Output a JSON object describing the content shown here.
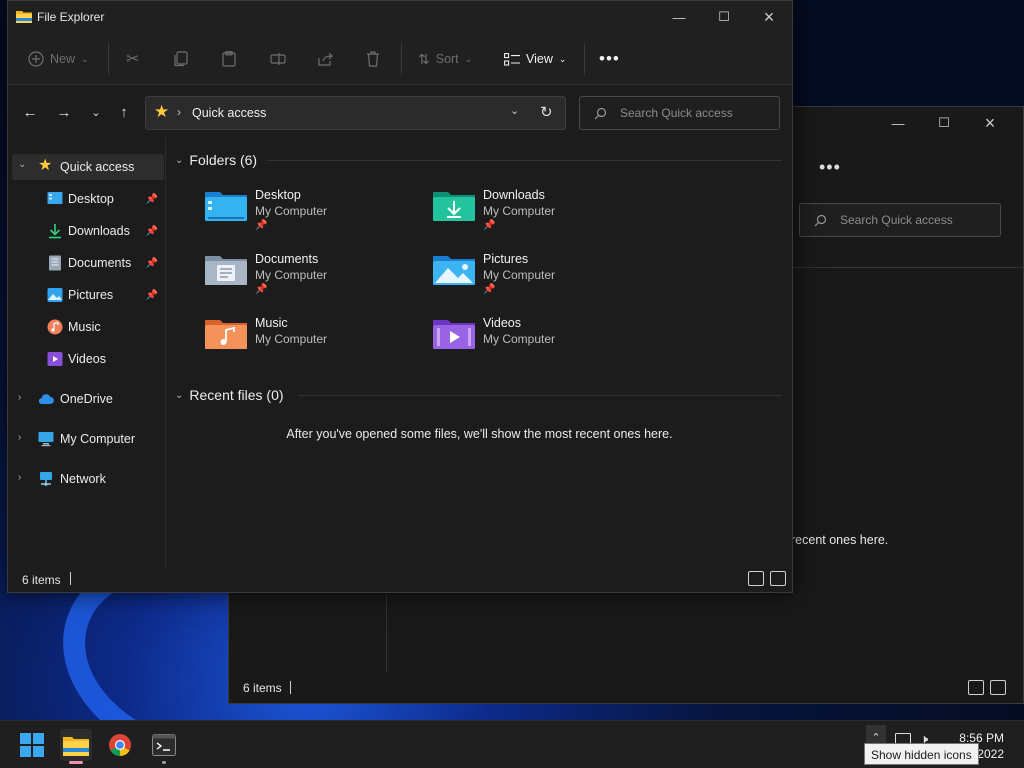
{
  "window": {
    "title": "File Explorer"
  },
  "toolbar": {
    "new_label": "New",
    "sort_label": "Sort",
    "view_label": "View"
  },
  "address": {
    "location": "Quick access"
  },
  "search": {
    "placeholder": "Search Quick access"
  },
  "sidebar": {
    "items": [
      {
        "label": "Quick access"
      },
      {
        "label": "Desktop"
      },
      {
        "label": "Downloads"
      },
      {
        "label": "Documents"
      },
      {
        "label": "Pictures"
      },
      {
        "label": "Music"
      },
      {
        "label": "Videos"
      },
      {
        "label": "OneDrive"
      },
      {
        "label": "My Computer"
      },
      {
        "label": "Network"
      }
    ]
  },
  "content": {
    "folders_header": "Folders (6)",
    "recent_header": "Recent files (0)",
    "recent_empty": "After you've opened some files, we'll show the most recent ones here.",
    "folders": [
      {
        "name": "Desktop",
        "location": "My Computer"
      },
      {
        "name": "Downloads",
        "location": "My Computer"
      },
      {
        "name": "Documents",
        "location": "My Computer"
      },
      {
        "name": "Pictures",
        "location": "My Computer"
      },
      {
        "name": "Music",
        "location": "My Computer"
      },
      {
        "name": "Videos",
        "location": "My Computer"
      }
    ]
  },
  "status": {
    "item_count": "6 items"
  },
  "back_window": {
    "search_placeholder": "Search Quick access",
    "empty_fragment": "recent ones here.",
    "item_count": "6 items"
  },
  "taskbar": {
    "time": "8:56 PM",
    "date_fragment": "2022",
    "tooltip": "Show hidden icons"
  },
  "colors": {
    "accent": "#ffc83d",
    "folder_blue": "#2aa3e8",
    "folder_green": "#1fb59a",
    "music_orange": "#f07a3a",
    "video_purple": "#8a4fd8"
  },
  "icons": {
    "sidebar": [
      "star-icon",
      "desktop-icon",
      "download-icon",
      "document-icon",
      "pictures-icon",
      "music-icon",
      "video-icon",
      "cloud-icon",
      "computer-icon",
      "network-icon"
    ]
  }
}
